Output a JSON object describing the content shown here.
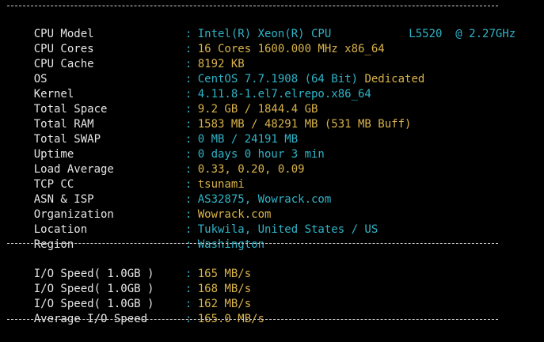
{
  "colors": {
    "background": "#000000",
    "label": "#e6e6e6",
    "cyan_value": "#2fb4c8",
    "yellow_value": "#d9b34a",
    "divider": "#d0d0d0"
  },
  "system_info": {
    "cpu_model": {
      "label": "CPU Model",
      "value_a": "Intel(R) Xeon(R) CPU",
      "value_b": "L5520  @ 2.27GHz"
    },
    "cpu_cores": {
      "label": "CPU Cores",
      "value": "16 Cores 1600.000 MHz x86_64"
    },
    "cpu_cache": {
      "label": "CPU Cache",
      "value": "8192 KB"
    },
    "os": {
      "label": "OS",
      "value": "CentOS 7.7.1908 (64 Bit)",
      "extra": "Dedicated"
    },
    "kernel": {
      "label": "Kernel",
      "value": "4.11.8-1.el7.elrepo.x86_64"
    },
    "total_space": {
      "label": "Total Space",
      "value": "9.2 GB / 1844.4 GB"
    },
    "total_ram": {
      "label": "Total RAM",
      "value": "1583 MB / 48291 MB (531 MB Buff)"
    },
    "total_swap": {
      "label": "Total SWAP",
      "value": "0 MB / 24191 MB"
    },
    "uptime": {
      "label": "Uptime",
      "value": "0 days 0 hour 3 min"
    },
    "load_average": {
      "label": "Load Average",
      "value": "0.33, 0.20, 0.09"
    },
    "tcp_cc": {
      "label": "TCP CC",
      "value": "tsunami"
    },
    "asn_isp": {
      "label": "ASN & ISP",
      "value": "AS32875, Wowrack.com"
    },
    "organization": {
      "label": "Organization",
      "value": "Wowrack.com"
    },
    "location": {
      "label": "Location",
      "value": "Tukwila, United States / US"
    },
    "region": {
      "label": "Region",
      "value": "Washington"
    }
  },
  "io_speed": [
    {
      "label": "I/O Speed( 1.0GB )",
      "value": "165 MB/s"
    },
    {
      "label": "I/O Speed( 1.0GB )",
      "value": "168 MB/s"
    },
    {
      "label": "I/O Speed( 1.0GB )",
      "value": "162 MB/s"
    },
    {
      "label": "Average I/O Speed",
      "value": "165.0 MB/s"
    }
  ],
  "separator": ":"
}
